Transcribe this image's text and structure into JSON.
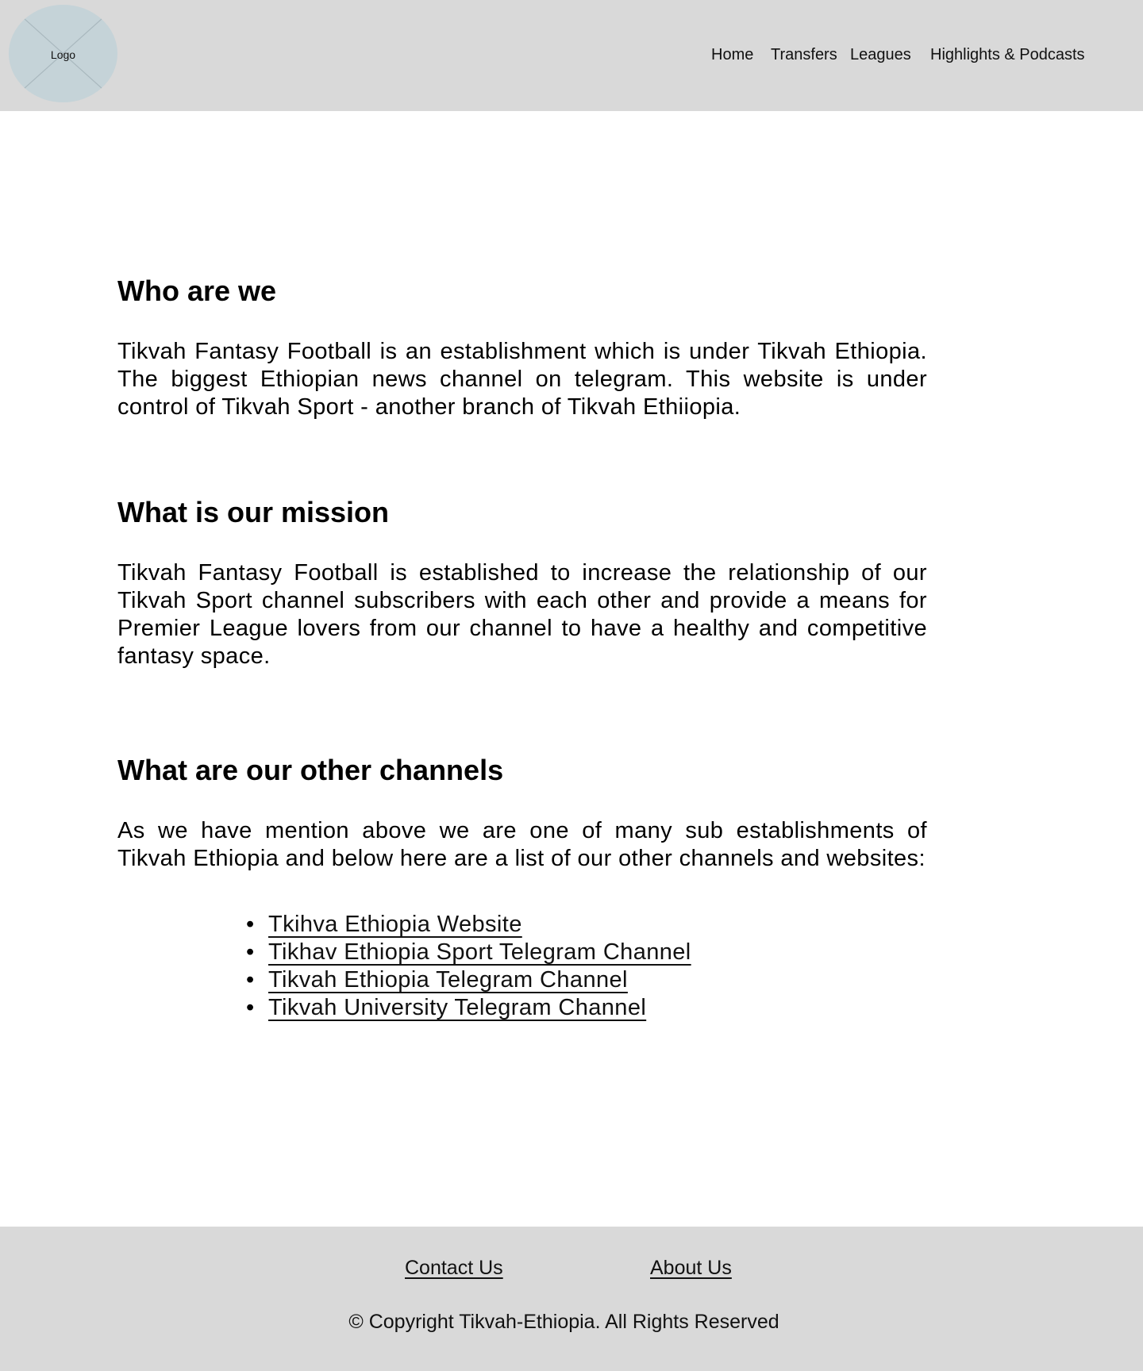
{
  "header": {
    "logo_label": "Logo",
    "nav": {
      "home": "Home",
      "transfers": "Transfers",
      "leagues": "Leagues",
      "highlights": "Highlights & Podcasts"
    }
  },
  "main": {
    "who": {
      "title": "Who are we",
      "text": "Tikvah Fantasy Football is an establishment which is under Tikvah Ethiopia. The biggest Ethiopian news channel on telegram. This website is under control of  Tikvah Sport - another branch of Tikvah Ethiiopia."
    },
    "mission": {
      "title": "What is our mission",
      "text": "Tikvah Fantasy Football is established to increase the relationship of our Tikvah Sport channel subscribers with each other and provide a means for Premier League lovers from our channel to have a healthy and competitive fantasy space."
    },
    "channels": {
      "title": "What are our other channels",
      "text": "As we have mention above we are one of many sub establishments of Tikvah Ethiopia and below here are a list of our other channels and websites:",
      "links": [
        "Tkihva Ethiopia Website",
        "Tikhav Ethiopia Sport Telegram Channel",
        "Tikvah Ethiopia Telegram Channel",
        "Tikvah University Telegram Channel"
      ]
    }
  },
  "footer": {
    "contact": "Contact Us",
    "about": "About Us",
    "copyright": "© Copyright Tikvah-Ethiopia. All Rights Reserved"
  },
  "colors": {
    "header_bg": "#d9d9d9",
    "footer_bg": "#d9d9d9",
    "logo_bg": "#c5d3d8",
    "text": "#000000"
  },
  "icons": {
    "logo_placeholder": "image-placeholder-icon",
    "list_bullet": "bullet-icon"
  }
}
